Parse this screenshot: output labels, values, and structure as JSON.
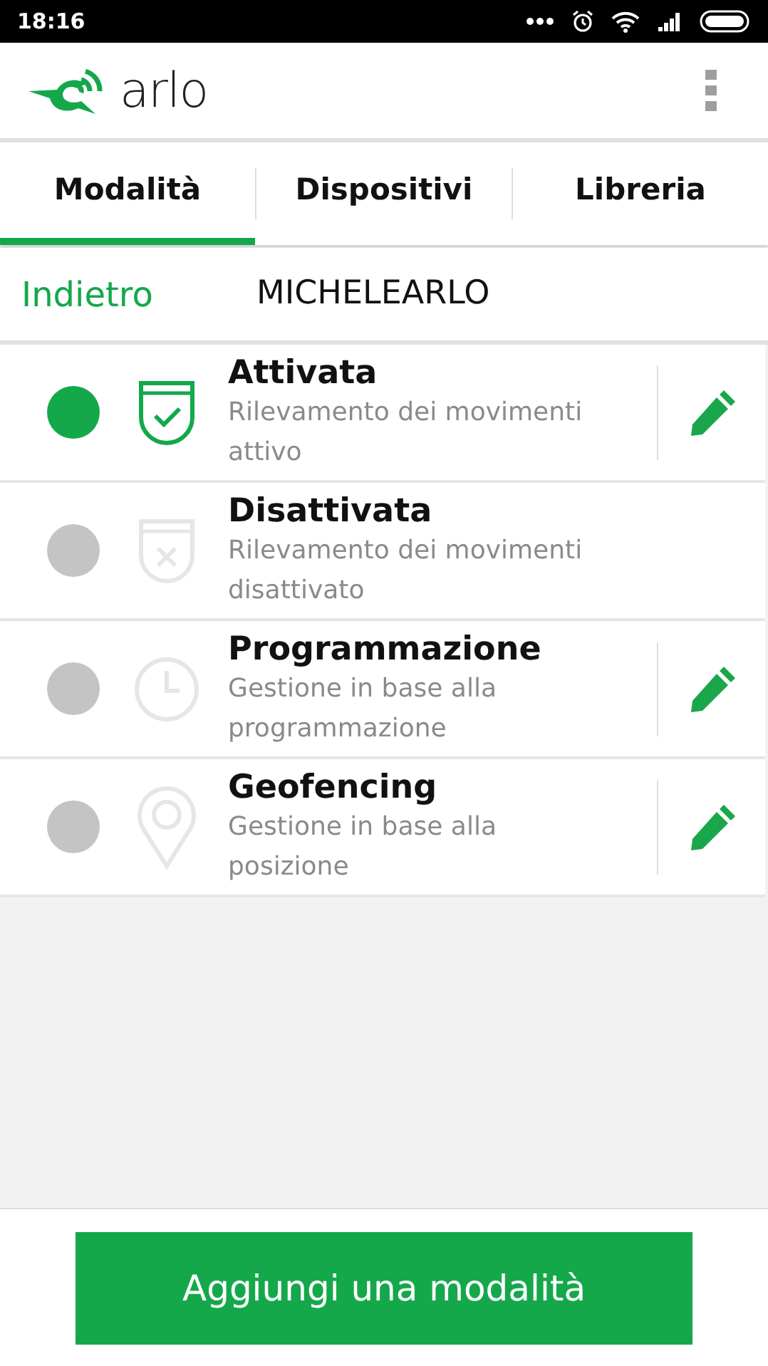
{
  "status_bar": {
    "time": "18:16"
  },
  "header": {
    "logo": "arlo"
  },
  "tabs": [
    {
      "label": "Modalità",
      "selected": true
    },
    {
      "label": "Dispositivi",
      "selected": false
    },
    {
      "label": "Libreria",
      "selected": false
    }
  ],
  "nav": {
    "back": "Indietro",
    "title": "MICHELEARLO"
  },
  "modes": [
    {
      "kind": "shield-check",
      "title": "Attivata",
      "description": "Rilevamento dei movimenti attivo",
      "selected": true,
      "editable": true
    },
    {
      "kind": "shield-x",
      "title": "Disattivata",
      "description": "Rilevamento dei movimenti disattivato",
      "selected": false,
      "editable": false
    },
    {
      "kind": "clock",
      "title": "Programmazione",
      "description": "Gestione in base alla programmazione",
      "selected": false,
      "editable": true
    },
    {
      "kind": "pin",
      "title": "Geofencing",
      "description": "Gestione in base alla posizione",
      "selected": false,
      "editable": true
    }
  ],
  "add_button": "Aggiungi una modalità"
}
